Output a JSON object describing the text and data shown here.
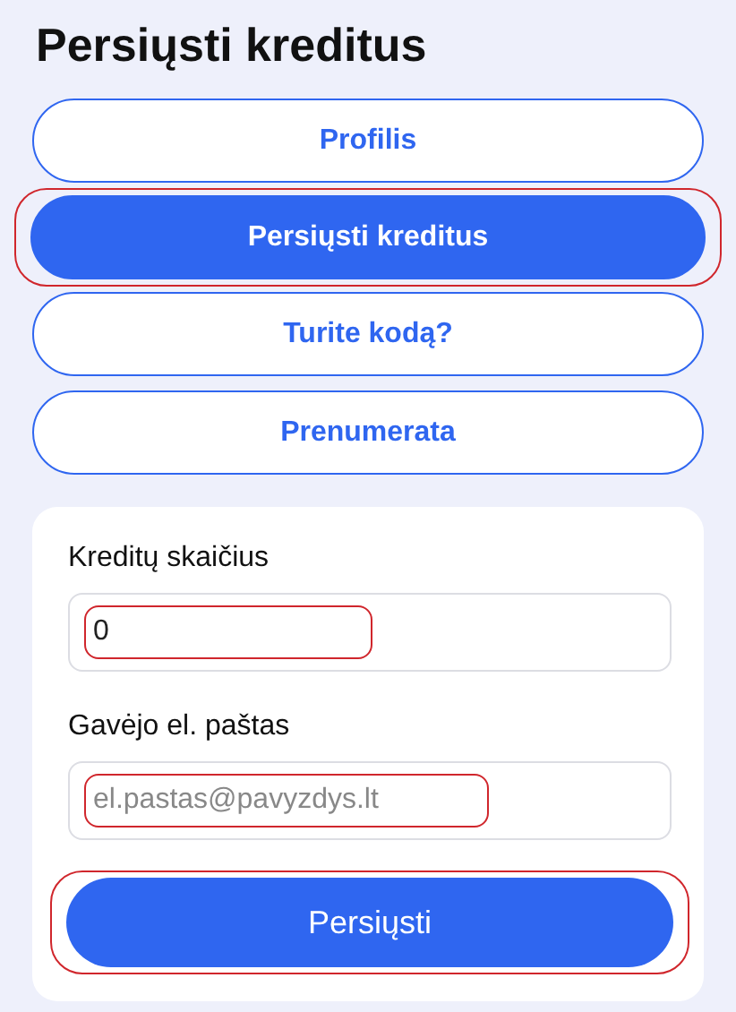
{
  "title": "Persiųsti kreditus",
  "tabs": [
    {
      "label": "Profilis",
      "selected": false,
      "highlighted": false
    },
    {
      "label": "Persiųsti kreditus",
      "selected": true,
      "highlighted": true
    },
    {
      "label": "Turite kodą?",
      "selected": false,
      "highlighted": false
    },
    {
      "label": "Prenumerata",
      "selected": false,
      "highlighted": false
    }
  ],
  "form": {
    "fields": [
      {
        "label": "Kreditų skaičius",
        "value": "0",
        "highlighted": true
      },
      {
        "label": "Gavėjo el. paštas",
        "placeholder": "el.pastas@pavyzdys.lt",
        "highlighted": true
      }
    ],
    "submit": {
      "label": "Persiųsti",
      "highlighted": true
    }
  }
}
